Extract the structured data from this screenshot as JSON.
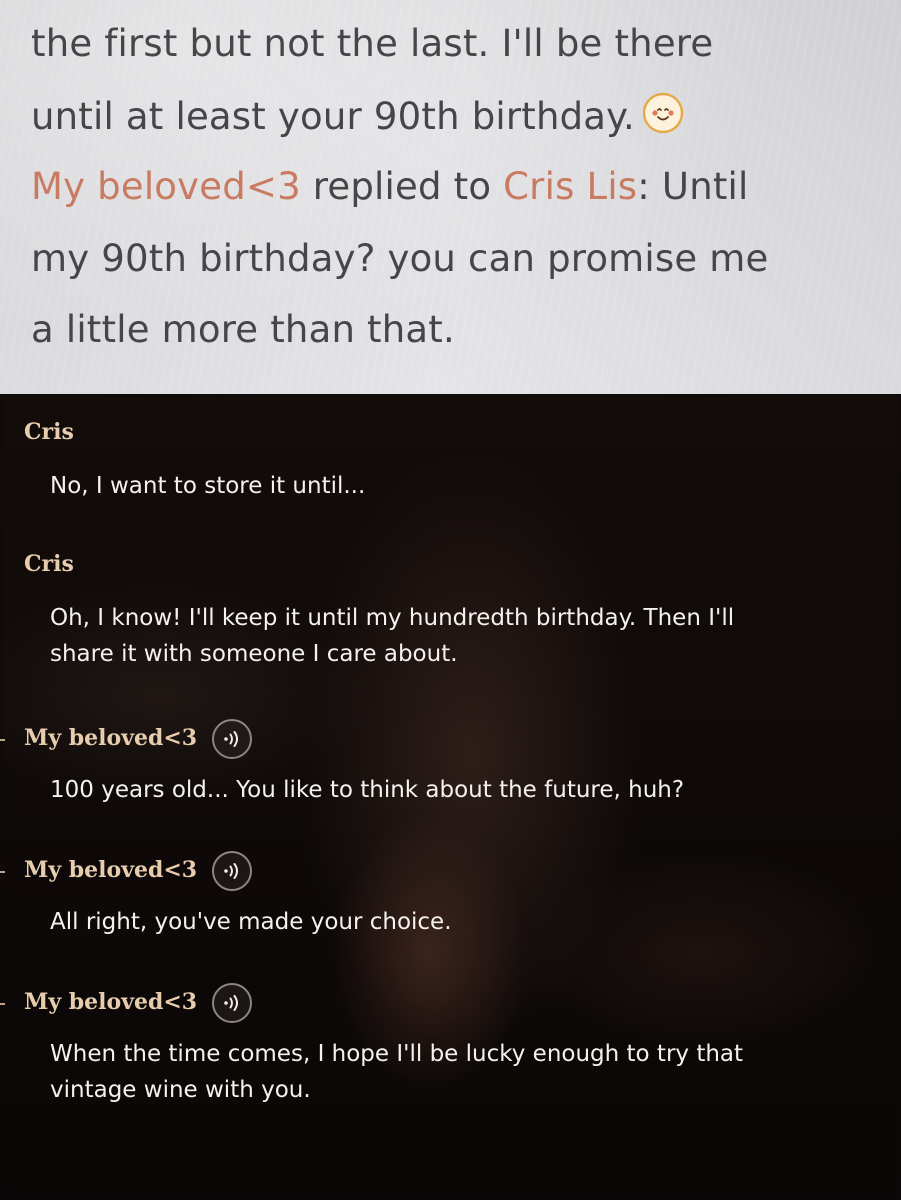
{
  "comment_thread": {
    "line1": "the first but not the last. I'll be there",
    "line2": "until at least your 90th birthday.",
    "emoji_icon": "smiley-emoji",
    "reply": {
      "author": "My beloved<3",
      "connector": " replied to ",
      "target": "Cris Lis",
      "text_start": ": Until",
      "text_line2": "my 90th birthday? you can promise me",
      "text_line3": "a little more than that."
    }
  },
  "dialogue": [
    {
      "speaker": "Cris",
      "voice": false,
      "lines": [
        "No, I want to store it until..."
      ]
    },
    {
      "speaker": "Cris",
      "voice": false,
      "lines": [
        "Oh, I know! I'll keep it until my hundredth birthday. Then I'll",
        "share it with someone I care about."
      ]
    },
    {
      "speaker": "My beloved<3",
      "voice": true,
      "voice_icon": "sound-wave-icon",
      "lines": [
        "100 years old... You like to think about the future, huh?"
      ]
    },
    {
      "speaker": "My beloved<3",
      "voice": true,
      "voice_icon": "sound-wave-icon",
      "lines": [
        "All right, you've made your choice."
      ]
    },
    {
      "speaker": "My beloved<3",
      "voice": true,
      "voice_icon": "sound-wave-icon",
      "lines": [
        "When the time comes, I hope I'll be lucky enough to try that",
        "vintage wine with you."
      ]
    }
  ],
  "colors": {
    "comment_text": "#464649",
    "user_link": "#c97b62",
    "speaker_name": "#e7cdae",
    "dialogue_text": "#f4f1ee"
  }
}
